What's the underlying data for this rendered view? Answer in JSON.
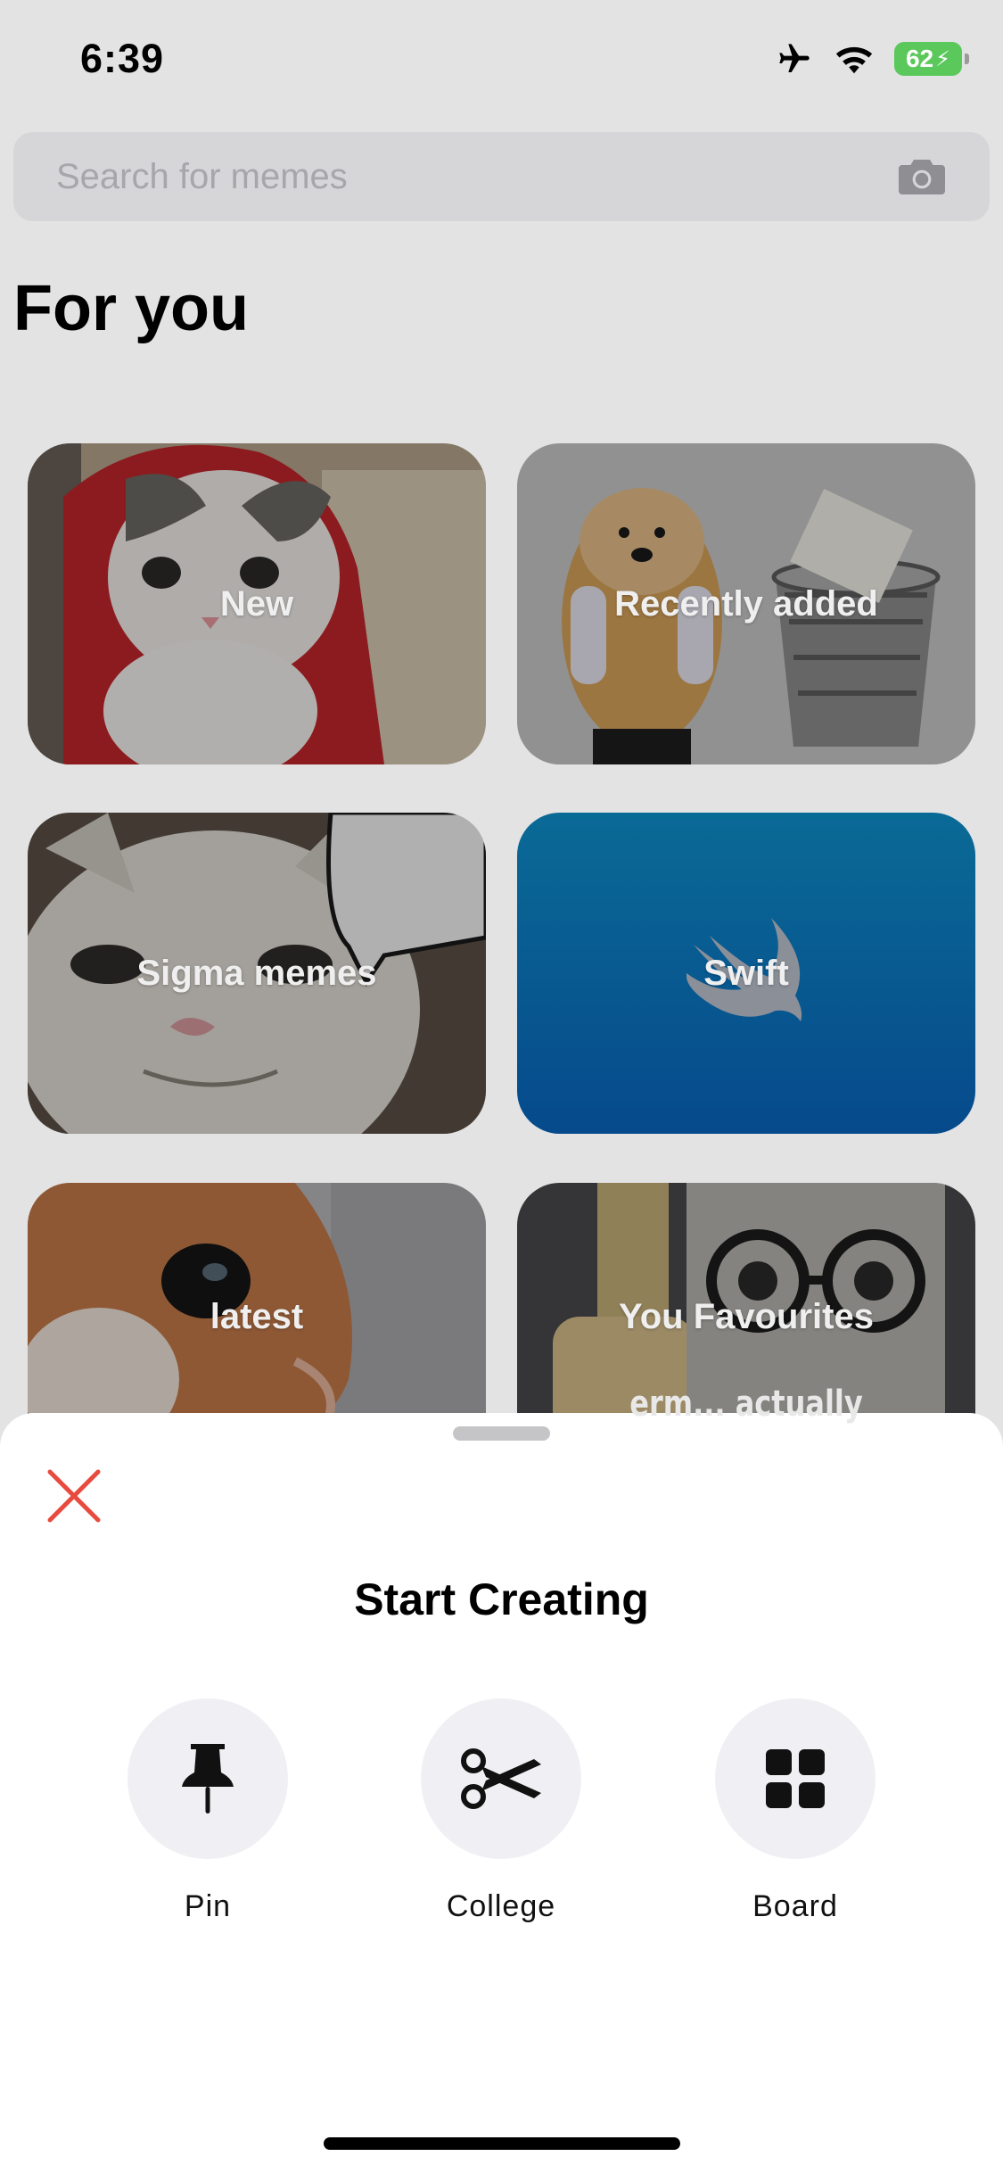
{
  "status_bar": {
    "time": "6:39",
    "battery": "62"
  },
  "search": {
    "placeholder": "Search for memes"
  },
  "section_title": "For you",
  "cards": [
    {
      "label": "New"
    },
    {
      "label": "Recently added"
    },
    {
      "label": "Sigma memes"
    },
    {
      "label": "Swift"
    },
    {
      "label": "latest"
    },
    {
      "label": "You Favourites",
      "caption": "erm... actually"
    }
  ],
  "sheet": {
    "title": "Start Creating",
    "actions": [
      {
        "label": "Pin",
        "icon": "pushpin-icon"
      },
      {
        "label": "College",
        "icon": "scissors-icon"
      },
      {
        "label": "Board",
        "icon": "grid-icon"
      }
    ]
  },
  "colors": {
    "close": "#e84a3f",
    "battery": "#5ac85a",
    "swift_gradient_top": "#0a6a96",
    "swift_gradient_bottom": "#064a8c"
  }
}
